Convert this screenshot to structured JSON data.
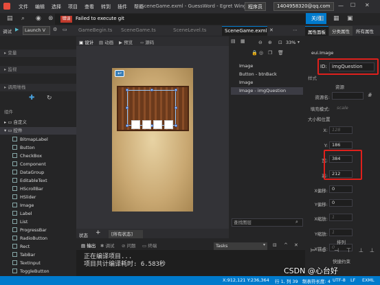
{
  "title": {
    "menus": [
      "文件",
      "编辑",
      "选择",
      "项目",
      "查看",
      "转到",
      "插件",
      "帮助"
    ],
    "window_title": "SceneGame.exml - GuessWord - Egret Wing",
    "role": "程序员",
    "account": "1404958320@qq.com",
    "close_label": "关闭"
  },
  "notify": {
    "tag": "错误",
    "message": "Failed to execute git"
  },
  "toolbar": {
    "debug_label": "调试",
    "launch_label": "Launch V",
    "tabs": [
      "GameBegin.ts",
      "SceneGame.ts",
      "SceneLevel.ts",
      "SceneGame.exml"
    ],
    "panel_tabs": [
      "属性面板",
      "分类属性",
      "所有属性"
    ]
  },
  "left": {
    "sections": [
      "变量",
      "监视",
      "调用堆栈",
      "组件"
    ],
    "tree": [
      "自定义",
      "控件"
    ],
    "components": [
      "BitmapLabel",
      "Button",
      "CheckBox",
      "Component",
      "DataGroup",
      "EditableText",
      "HScrollBar",
      "HSlider",
      "Image",
      "Label",
      "List",
      "ProgressBar",
      "RadioButton",
      "Rect",
      "TabBar",
      "TextInput",
      "ToggleButton",
      "ToggleSwitch"
    ]
  },
  "editor": {
    "modes": [
      "设计",
      "动画",
      "预览",
      "源码"
    ],
    "zoom": "33%"
  },
  "layers": {
    "items": [
      "Image",
      "Button - btnBack",
      "Image",
      "Image - imgQuestion"
    ],
    "search_placeholder": "查找图层"
  },
  "props": {
    "type": "eui.Image",
    "id_label": "ID:",
    "id_value": "imgQuestion",
    "section_style": "样式",
    "section_res": "资源",
    "res_label": "资源名:",
    "fill_label": "填充模式:",
    "fill_value": "scale",
    "section_size": "大小和位置",
    "fields": [
      {
        "label": "X:",
        "value": "128",
        "dim": true
      },
      {
        "label": "Y:",
        "value": "186",
        "dim": false
      },
      {
        "label": "宽:",
        "value": "384",
        "dim": false
      },
      {
        "label": "高:",
        "value": "212",
        "dim": false
      },
      {
        "label": "X偏移:",
        "value": "0",
        "dim": false
      },
      {
        "label": "Y偏移:",
        "value": "0",
        "dim": false
      },
      {
        "label": "X缩放:",
        "value": "1",
        "dim": true
      },
      {
        "label": "Y缩放:",
        "value": "1",
        "dim": true
      },
      {
        "label": "X锚点:",
        "value": "0",
        "dim": true
      }
    ],
    "section_layout": "排列",
    "section_constraint": "快捷约束"
  },
  "output": {
    "tabs": [
      "状态",
      "[所有状态]"
    ],
    "subtabs": [
      "输出",
      "调试",
      "问题",
      "终端"
    ],
    "select_value": "Tasks",
    "lines": [
      "正在编译项目...",
      "项目共计编译耗时: 6.583秒"
    ]
  },
  "status": {
    "coords": "X:912,121 Y:236,364",
    "cursor": "行 1, 列 39",
    "indent": "制表符长度: 4",
    "encoding": "UTF-8",
    "eol": "LF",
    "lang": "EXML",
    "watermark": "CSDN @心台好"
  }
}
